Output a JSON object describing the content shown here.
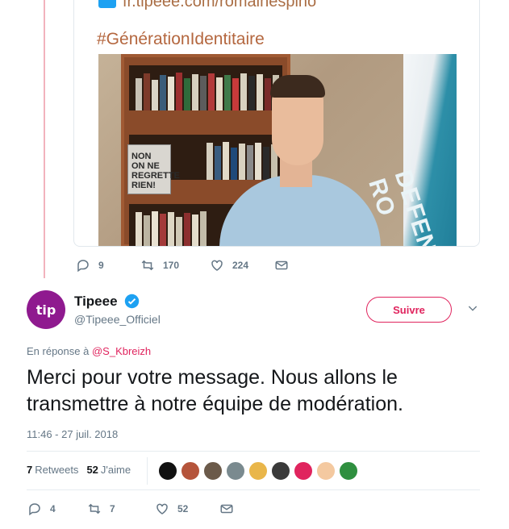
{
  "quoted_tweet": {
    "link_text": "fr.tipeee.com/romainespino",
    "hashtag": "#GénérationIdentitaire",
    "poster_text": "NON\nON NE\nREGRETTE\nRIEN!",
    "flag_text": "DEFEN RO",
    "actions": {
      "replies": "9",
      "retweets": "170",
      "likes": "224"
    }
  },
  "tweet": {
    "author_name": "Tipeee",
    "author_handle": "@Tipeee_Officiel",
    "avatar_text": "tip",
    "follow_label": "Suivre",
    "reply_prefix": "En réponse à",
    "reply_mention": "@S_Kbreizh",
    "text": "Merci pour votre message. Nous allons le transmettre à notre équipe de modération.",
    "timestamp": "11:46 - 27 juil. 2018",
    "stats": {
      "retweets_count": "7",
      "retweets_label": "Retweets",
      "likes_count": "52",
      "likes_label": "J'aime"
    },
    "actions": {
      "replies": "4",
      "retweets": "7",
      "likes": "52"
    }
  },
  "colors": {
    "accent": "#e0245e",
    "verified": "#1da1f2",
    "muted": "#657786",
    "thread_line": "#f2b3bd"
  },
  "liker_avatars": [
    "#111111",
    "#b5543b",
    "#6b5a4a",
    "#7a8a8f",
    "#e9b64a",
    "#3a3a3a",
    "#e0245e",
    "#f4c9a0",
    "#2f8f3f"
  ]
}
